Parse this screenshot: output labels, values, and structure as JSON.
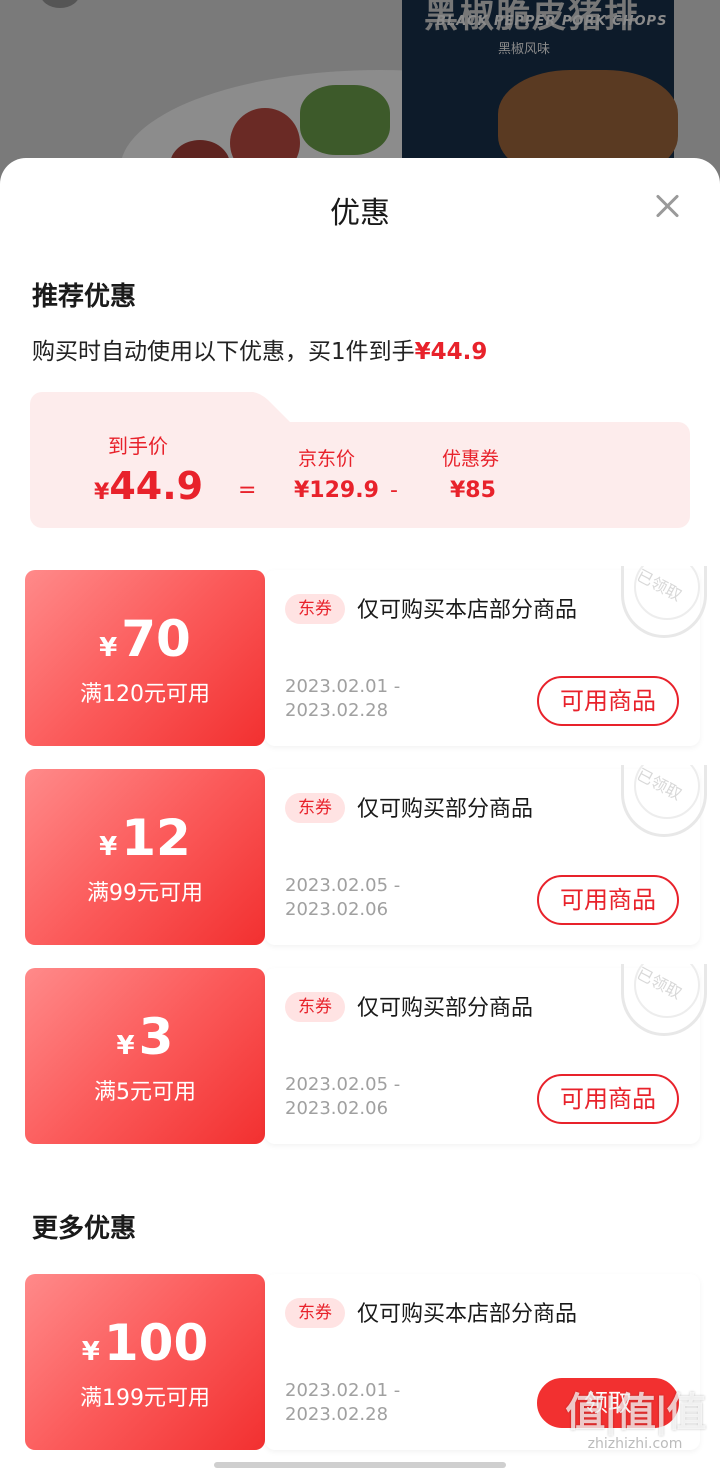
{
  "background": {
    "package_title": "黑椒脆皮猪排",
    "package_subtitle": "BLACK PEPPER PORK CHOPS",
    "package_flavor": "黑椒风味"
  },
  "sheet": {
    "title": "优惠"
  },
  "recommended": {
    "title": "推荐优惠",
    "desc_prefix": "购买时自动使用以下优惠，买1件到手",
    "desc_price": "¥44.9"
  },
  "summary": {
    "final_label": "到手价",
    "final_yen": "¥",
    "final_price": "44.9",
    "equals": "=",
    "jd_label": "京东价",
    "jd_price": "¥129.9",
    "minus": "-",
    "coupon_label": "优惠券",
    "coupon_price": "¥85"
  },
  "coupons": [
    {
      "yen": "¥",
      "amount": "70",
      "condition": "满120元可用",
      "tag": "东券",
      "text": "仅可购买本店部分商品",
      "date_start": "2023.02.01  -",
      "date_end": "2023.02.28",
      "button": "可用商品",
      "stamp": "已领取"
    },
    {
      "yen": "¥",
      "amount": "12",
      "condition": "满99元可用",
      "tag": "东券",
      "text": "仅可购买部分商品",
      "date_start": "2023.02.05  -",
      "date_end": "2023.02.06",
      "button": "可用商品",
      "stamp": "已领取"
    },
    {
      "yen": "¥",
      "amount": "3",
      "condition": "满5元可用",
      "tag": "东券",
      "text": "仅可购买部分商品",
      "date_start": "2023.02.05  -",
      "date_end": "2023.02.06",
      "button": "可用商品",
      "stamp": "已领取"
    }
  ],
  "more": {
    "title": "更多优惠",
    "coupon": {
      "yen": "¥",
      "amount": "100",
      "condition": "满199元可用",
      "tag": "东券",
      "text": "仅可购买本店部分商品",
      "date_start": "2023.02.01  -",
      "date_end": "2023.02.28",
      "button": "领取"
    }
  },
  "watermark": {
    "logo": "值|值|值",
    "url": "zhizhizhi.com"
  },
  "colors": {
    "accent": "#e8222b",
    "coupon_gradient_start": "#ff8a8a",
    "coupon_gradient_end": "#f23030",
    "summary_bg": "#fdecec",
    "overlay": "#6f6f6f"
  }
}
